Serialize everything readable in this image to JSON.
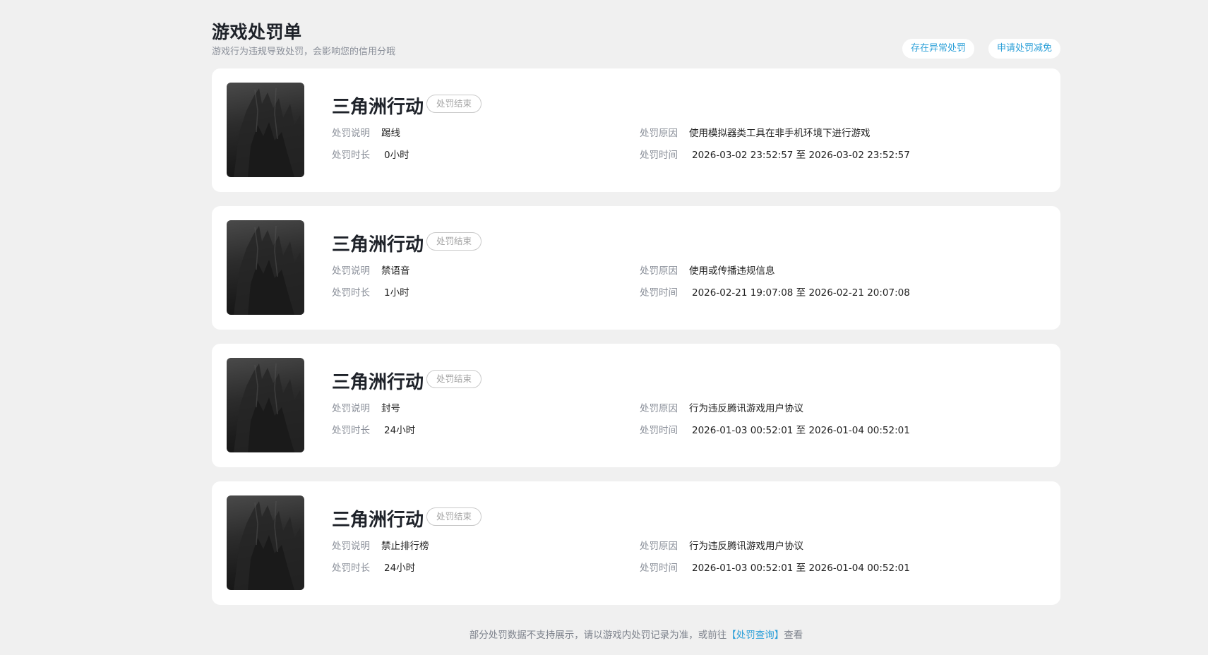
{
  "header": {
    "title": "游戏处罚单",
    "subtitle": "游戏行为违规导致处罚，会影响您的信用分哦",
    "actions": [
      {
        "label": "存在异常处罚"
      },
      {
        "label": "申请处罚减免"
      }
    ]
  },
  "labels": {
    "desc": "处罚说明",
    "duration": "处罚时长",
    "reason": "处罚原因",
    "time": "处罚时间"
  },
  "penalties": [
    {
      "game": "三角洲行动",
      "status": "处罚结束",
      "desc": "踢线",
      "duration": "0小时",
      "reason": "使用模拟器类工具在非手机环境下进行游戏",
      "time": "2026-03-02 23:52:57 至 2026-03-02 23:52:57"
    },
    {
      "game": "三角洲行动",
      "status": "处罚结束",
      "desc": "禁语音",
      "duration": "1小时",
      "reason": "使用或传播违规信息",
      "time": "2026-02-21 19:07:08 至 2026-02-21 20:07:08"
    },
    {
      "game": "三角洲行动",
      "status": "处罚结束",
      "desc": "封号",
      "duration": "24小时",
      "reason": "行为违反腾讯游戏用户协议",
      "time": "2026-01-03 00:52:01 至 2026-01-04 00:52:01"
    },
    {
      "game": "三角洲行动",
      "status": "处罚结束",
      "desc": "禁止排行榜",
      "duration": "24小时",
      "reason": "行为违反腾讯游戏用户协议",
      "time": "2026-01-03 00:52:01 至 2026-01-04 00:52:01"
    }
  ],
  "footer": {
    "text_before": "部分处罚数据不支持展示，请以游戏内处罚记录为准，或前往",
    "link": "【处罚查询】",
    "text_after": "查看"
  }
}
